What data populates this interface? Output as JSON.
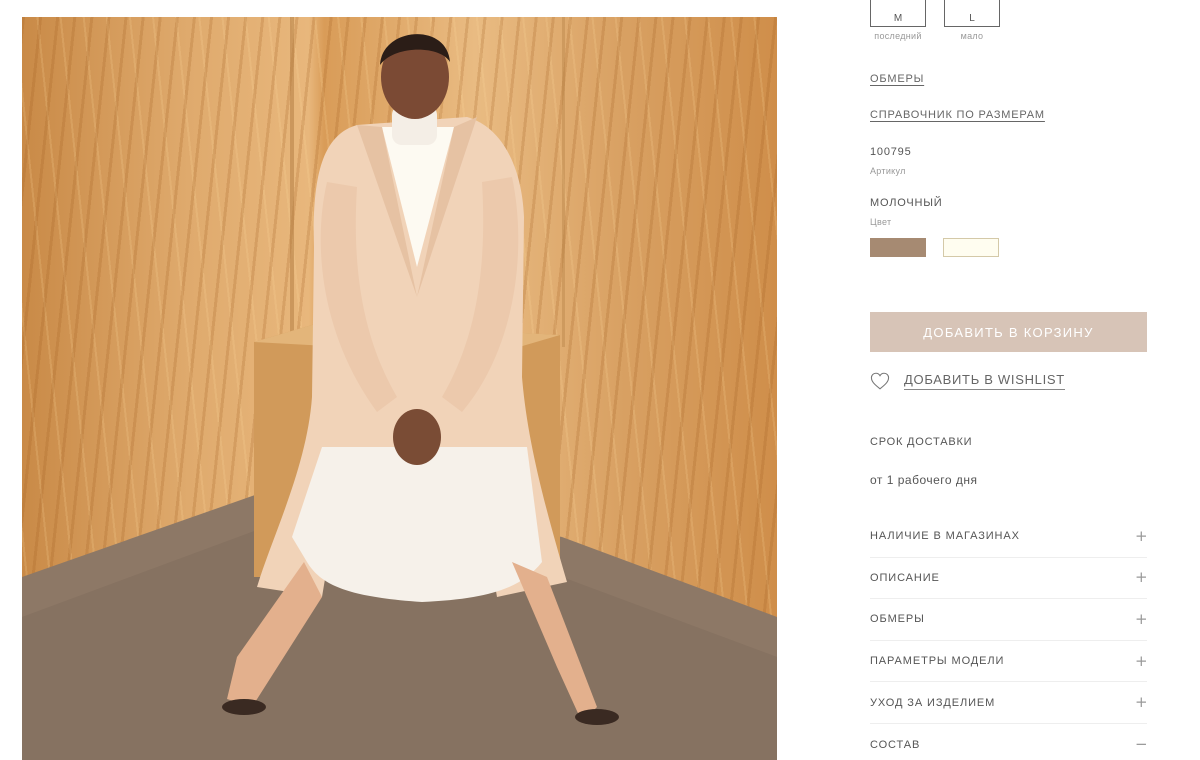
{
  "product_image": {
    "alt": "",
    "icon": "product-photo"
  },
  "sizes": [
    {
      "label": "M",
      "note": "последний"
    },
    {
      "label": "L",
      "note": "мало"
    }
  ],
  "links": {
    "measurements": "ОБМЕРЫ",
    "size_guide": "СПРАВОЧНИК ПО РАЗМЕРАМ"
  },
  "article": {
    "value": "100795",
    "caption": "Артикул"
  },
  "color": {
    "value": "МОЛОЧНЫЙ",
    "caption": "Цвет",
    "swatches": [
      {
        "name": "brown",
        "hex": "#a68a72"
      },
      {
        "name": "milk",
        "hex": "#fffdf0"
      }
    ]
  },
  "actions": {
    "add_to_cart": "ДОБАВИТЬ В КОРЗИНУ",
    "add_to_wishlist": "ДОБАВИТЬ В WISHLIST",
    "cart_button_color": "#d7c4b7"
  },
  "delivery": {
    "title": "СРОК ДОСТАВКИ",
    "text": "от 1 рабочего дня"
  },
  "accordion": [
    {
      "label": "НАЛИЧИЕ В МАГАЗИНАХ",
      "icon": "+"
    },
    {
      "label": "ОПИСАНИЕ",
      "icon": "+"
    },
    {
      "label": "ОБМЕРЫ",
      "icon": "+"
    },
    {
      "label": "ПАРАМЕТРЫ МОДЕЛИ",
      "icon": "+"
    },
    {
      "label": "УХОД ЗА ИЗДЕЛИЕМ",
      "icon": "+"
    },
    {
      "label": "СОСТАВ",
      "icon": "−"
    }
  ]
}
